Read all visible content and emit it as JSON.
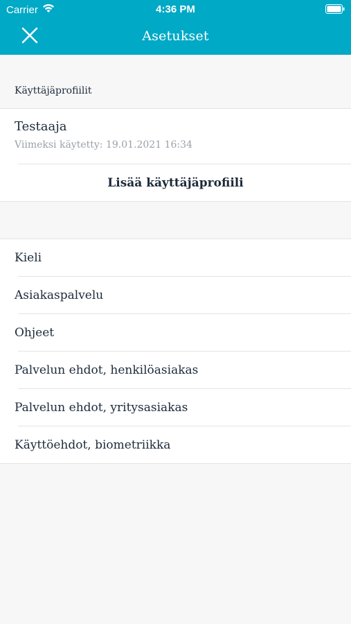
{
  "status_bar": {
    "carrier": "Carrier",
    "time": "4:36 PM"
  },
  "nav": {
    "title": "Asetukset",
    "close_icon": "close-icon"
  },
  "profiles": {
    "section_label": "Käyttäjäprofiilit",
    "items": [
      {
        "name": "Testaaja",
        "last_used": "Viimeksi käytetty: 19.01.2021 16:34"
      }
    ],
    "add_label": "Lisää käyttäjäprofiili"
  },
  "settings": {
    "items": [
      {
        "label": "Kieli"
      },
      {
        "label": "Asiakaspalvelu"
      },
      {
        "label": "Ohjeet"
      },
      {
        "label": "Palvelun ehdot, henkilöasiakas"
      },
      {
        "label": "Palvelun ehdot, yritysasiakas"
      },
      {
        "label": "Käyttöehdot, biometriikka"
      }
    ]
  },
  "colors": {
    "header_bg": "#00a9c6",
    "background": "#f7f7f7",
    "text": "#1c2a3a",
    "subtext": "#9aa1a8"
  }
}
